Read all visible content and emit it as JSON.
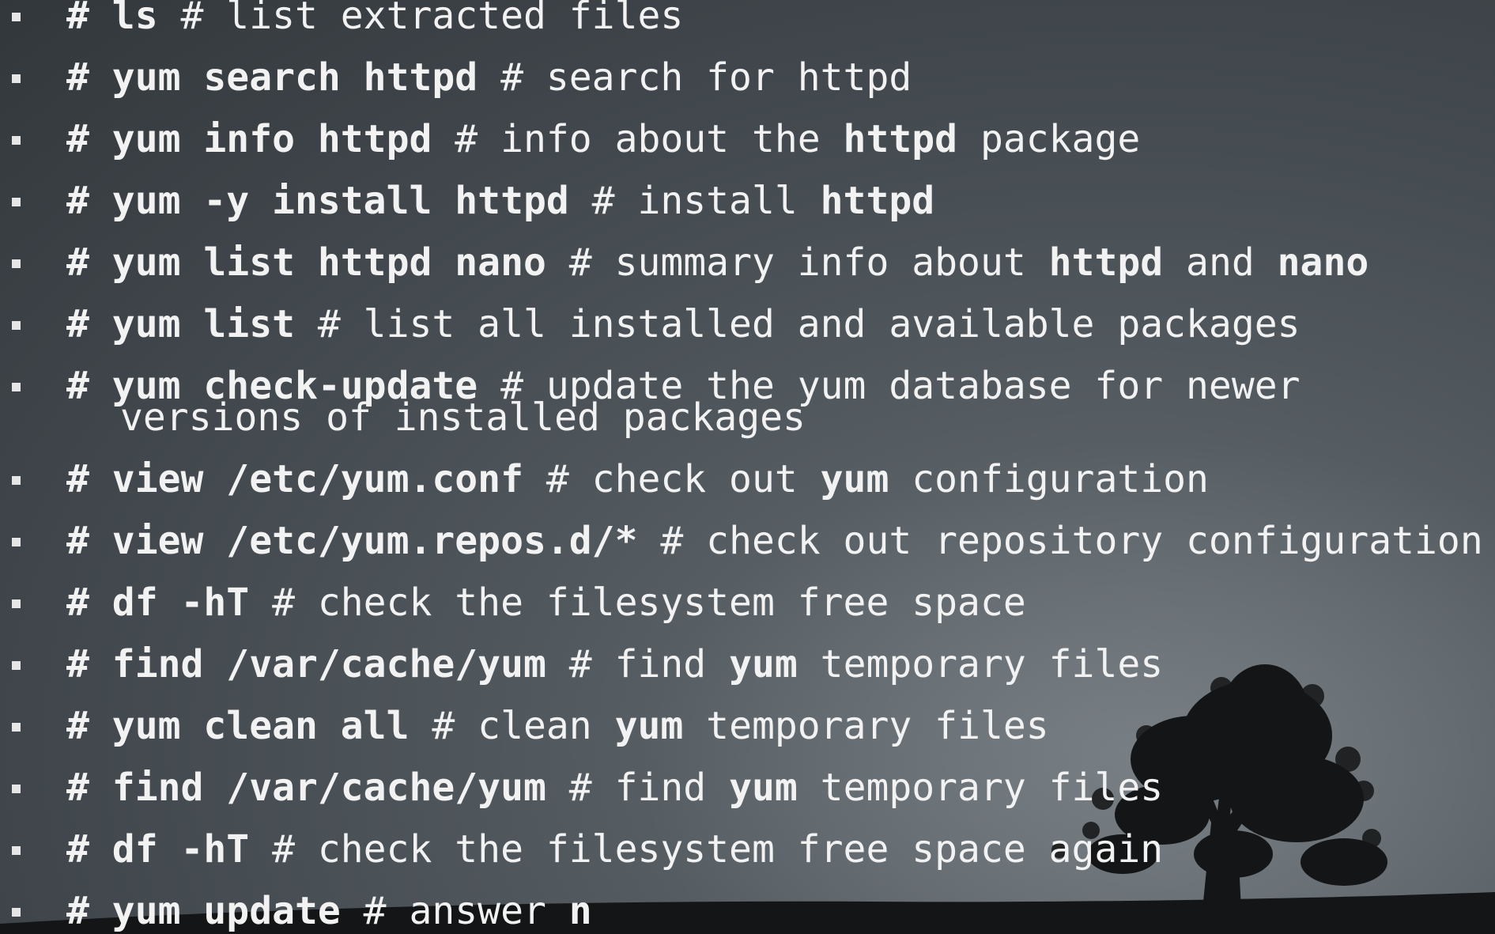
{
  "items": [
    {
      "segments": [
        {
          "t": "# ",
          "b": true
        },
        {
          "t": "ls",
          "b": true
        },
        {
          "t": " # list extracted files",
          "b": false
        }
      ]
    },
    {
      "segments": [
        {
          "t": "# ",
          "b": true
        },
        {
          "t": "yum search httpd",
          "b": true
        },
        {
          "t": " # search for httpd",
          "b": false
        }
      ]
    },
    {
      "segments": [
        {
          "t": "# ",
          "b": true
        },
        {
          "t": "yum info httpd",
          "b": true
        },
        {
          "t": " # info about the ",
          "b": false
        },
        {
          "t": "httpd",
          "b": true
        },
        {
          "t": " package",
          "b": false
        }
      ]
    },
    {
      "segments": [
        {
          "t": "# ",
          "b": true
        },
        {
          "t": "yum -y install httpd",
          "b": true
        },
        {
          "t": " # install ",
          "b": false
        },
        {
          "t": "httpd",
          "b": true
        }
      ]
    },
    {
      "segments": [
        {
          "t": "# ",
          "b": true
        },
        {
          "t": "yum list httpd nano",
          "b": true
        },
        {
          "t": " # summary info about ",
          "b": false
        },
        {
          "t": "httpd",
          "b": true
        },
        {
          "t": " and ",
          "b": false
        },
        {
          "t": "nano",
          "b": true
        }
      ]
    },
    {
      "segments": [
        {
          "t": "# ",
          "b": true
        },
        {
          "t": "yum list",
          "b": true
        },
        {
          "t": " # list all installed and available packages",
          "b": false
        }
      ]
    },
    {
      "segments": [
        {
          "t": "# ",
          "b": true
        },
        {
          "t": "yum check-update",
          "b": true
        },
        {
          "t": " # update the yum database for newer",
          "b": false
        }
      ],
      "continuation": "versions of installed packages"
    },
    {
      "segments": [
        {
          "t": "# ",
          "b": true
        },
        {
          "t": "view /etc/yum.conf",
          "b": true
        },
        {
          "t": " # check out ",
          "b": false
        },
        {
          "t": "yum",
          "b": true
        },
        {
          "t": " configuration",
          "b": false
        }
      ]
    },
    {
      "segments": [
        {
          "t": "# ",
          "b": true
        },
        {
          "t": "view /etc/yum.repos.d/*",
          "b": true
        },
        {
          "t": " # check out repository configuration",
          "b": false
        }
      ]
    },
    {
      "segments": [
        {
          "t": "# ",
          "b": true
        },
        {
          "t": "df -hT",
          "b": true
        },
        {
          "t": " # check the filesystem free space",
          "b": false
        }
      ]
    },
    {
      "segments": [
        {
          "t": "# ",
          "b": true
        },
        {
          "t": "find /var/cache/yum",
          "b": true
        },
        {
          "t": " # find ",
          "b": false
        },
        {
          "t": "yum",
          "b": true
        },
        {
          "t": " temporary files",
          "b": false
        }
      ]
    },
    {
      "segments": [
        {
          "t": "# ",
          "b": true
        },
        {
          "t": "yum clean all",
          "b": true
        },
        {
          "t": " # clean ",
          "b": false
        },
        {
          "t": "yum",
          "b": true
        },
        {
          "t": " temporary files",
          "b": false
        }
      ]
    },
    {
      "segments": [
        {
          "t": "# ",
          "b": true
        },
        {
          "t": "find /var/cache/yum",
          "b": true
        },
        {
          "t": " # find ",
          "b": false
        },
        {
          "t": "yum",
          "b": true
        },
        {
          "t": " temporary files",
          "b": false
        }
      ]
    },
    {
      "segments": [
        {
          "t": "# ",
          "b": true
        },
        {
          "t": "df -hT",
          "b": true
        },
        {
          "t": " # check the filesystem free space again",
          "b": false
        }
      ]
    },
    {
      "segments": [
        {
          "t": "# ",
          "b": true
        },
        {
          "t": "yum update",
          "b": true
        },
        {
          "t": " # answer ",
          "b": false
        },
        {
          "t": "n",
          "b": true
        }
      ]
    }
  ],
  "colors": {
    "text": "#f2f2f2",
    "bullet": "#e6e6e6",
    "background": "#464c52",
    "silhouette": "#141516"
  },
  "decoration": {
    "icon": "tree-silhouette-icon"
  }
}
